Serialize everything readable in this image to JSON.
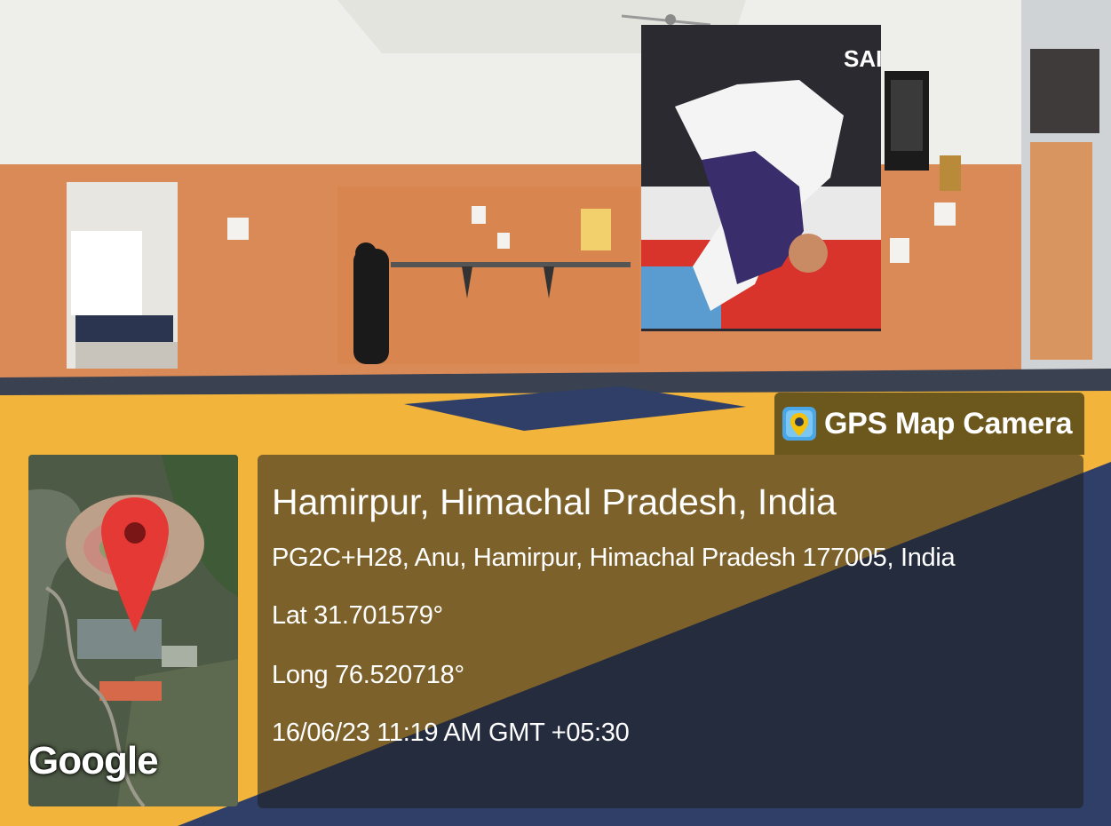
{
  "brand": {
    "label": "GPS Map Camera",
    "icon": "map-pin-camera-icon"
  },
  "map": {
    "provider_label": "Google",
    "pin_icon": "map-pin-icon",
    "pin_color": "#e53935"
  },
  "location": {
    "title": "Hamirpur, Himachal Pradesh, India",
    "address": "PG2C+H28, Anu, Hamirpur, Himachal Pradesh 177005, India",
    "latitude": "Lat 31.701579°",
    "longitude": "Long 76.520718°",
    "datetime": "16/06/23 11:19 AM GMT +05:30"
  },
  "scene": {
    "banner_logo": "SAI",
    "mat_color": "#f2b43a",
    "wall_color": "#d98a57"
  }
}
